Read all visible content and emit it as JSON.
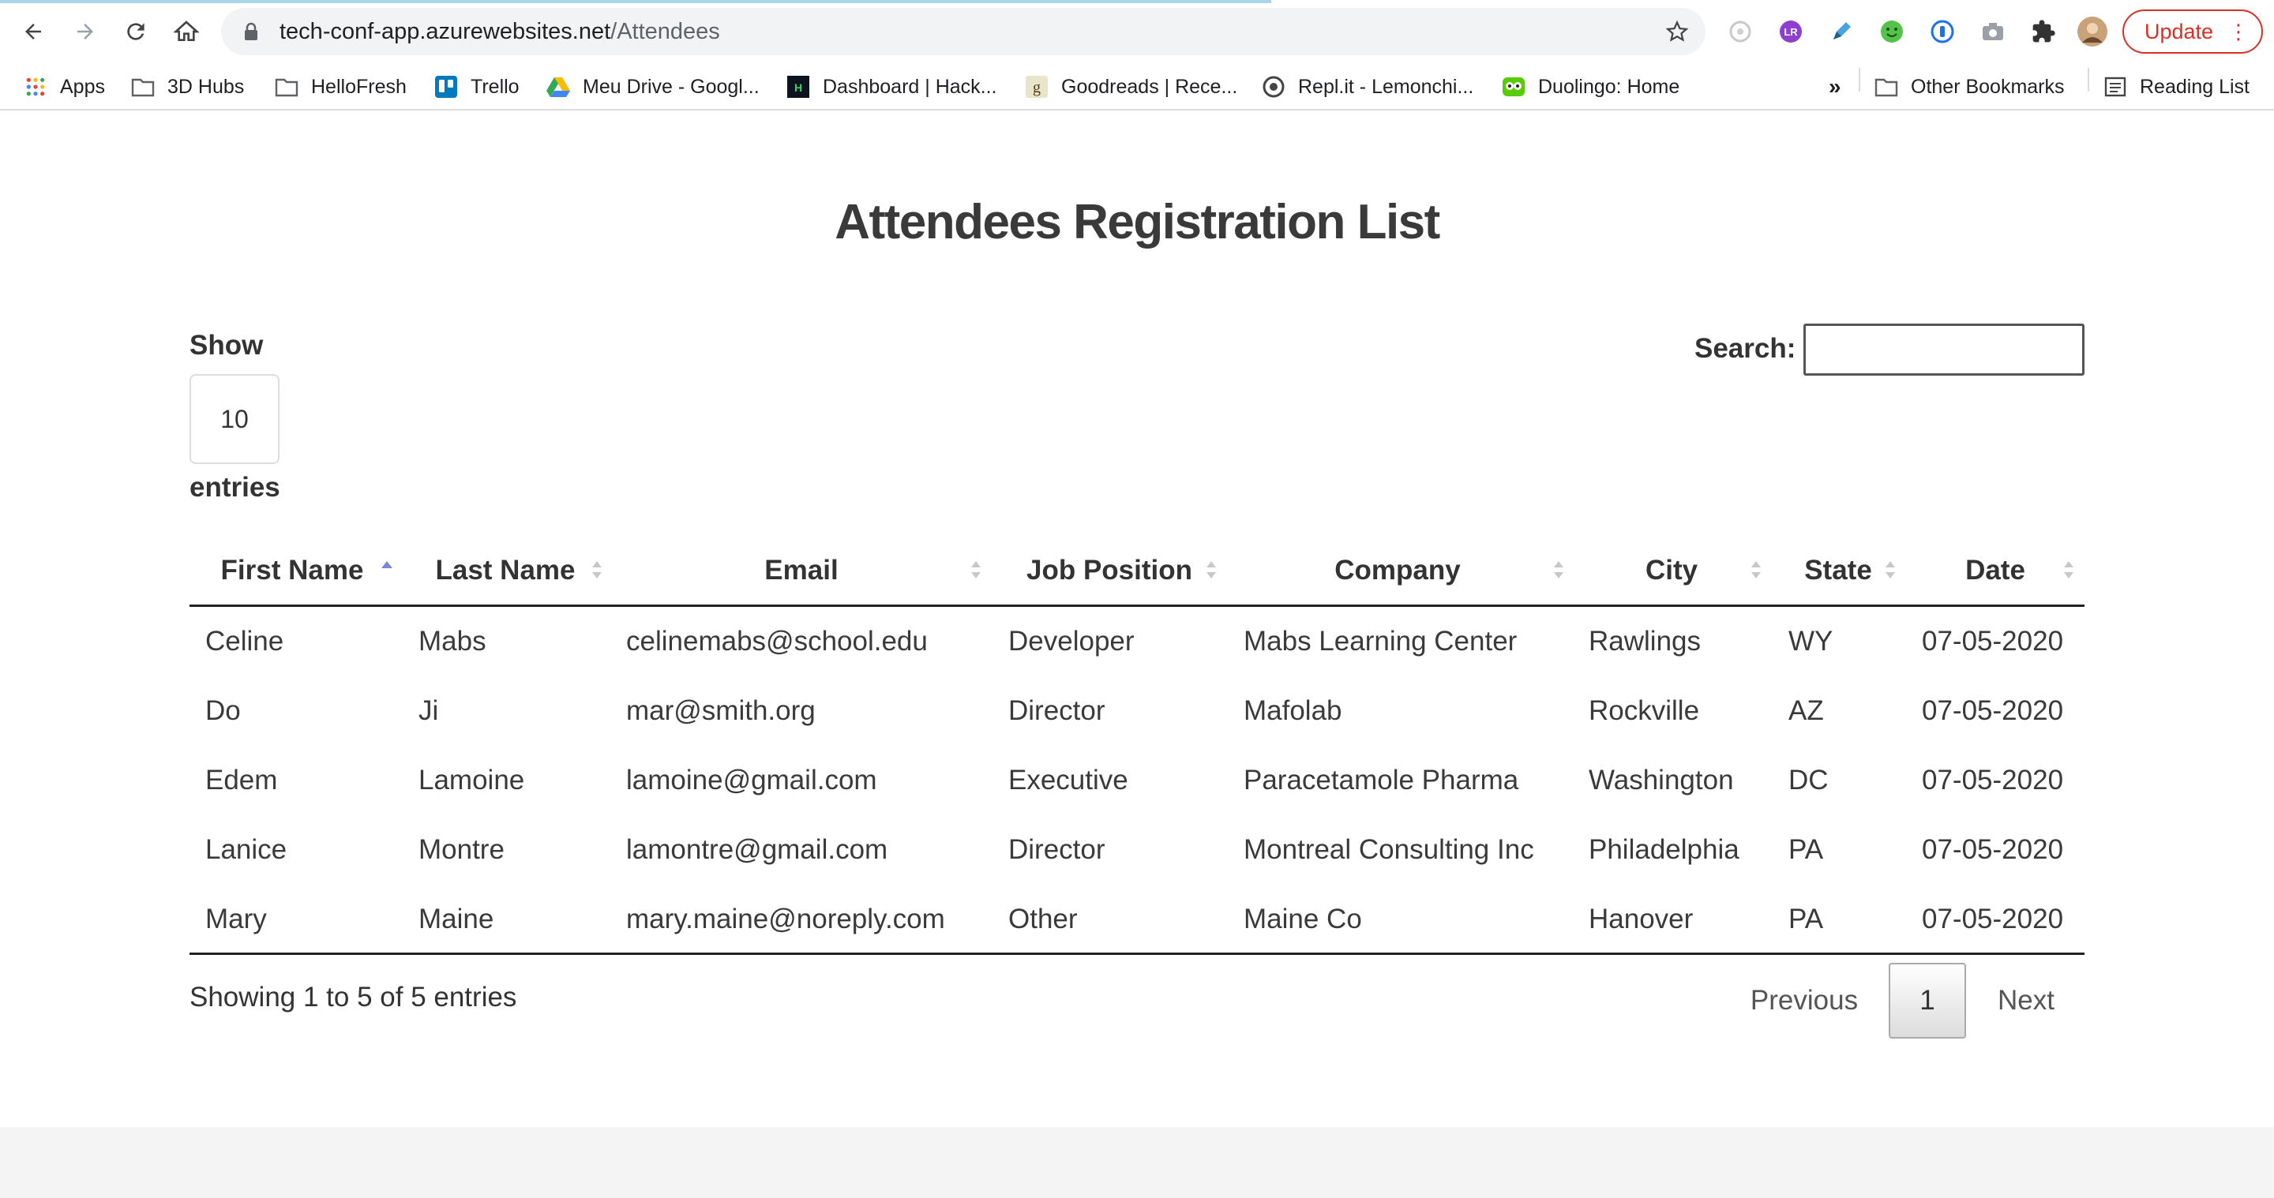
{
  "browser": {
    "url_host": "tech-conf-app.azurewebsites.net",
    "url_path": "/Attendees",
    "update_label": "Update",
    "bookmarks": [
      {
        "label": "Apps",
        "icon": "apps-grid-icon"
      },
      {
        "label": "3D Hubs",
        "icon": "folder-icon"
      },
      {
        "label": "HelloFresh",
        "icon": "folder-icon"
      },
      {
        "label": "Trello",
        "icon": "trello-icon"
      },
      {
        "label": "Meu Drive - Googl...",
        "icon": "google-drive-icon"
      },
      {
        "label": "Dashboard | Hack...",
        "icon": "hackerrank-icon"
      },
      {
        "label": "Goodreads | Rece...",
        "icon": "goodreads-icon"
      },
      {
        "label": "Repl.it - Lemonchi...",
        "icon": "replit-icon"
      },
      {
        "label": "Duolingo: Home",
        "icon": "duolingo-icon"
      }
    ],
    "overflow_label": "»",
    "other_bookmarks": "Other Bookmarks",
    "reading_list": "Reading List"
  },
  "page": {
    "title": "Attendees Registration List",
    "show_label": "Show",
    "page_length": "10",
    "entries_label": "entries",
    "search_label": "Search:",
    "search_value": ""
  },
  "table": {
    "columns": [
      "First Name",
      "Last Name",
      "Email",
      "Job Position",
      "Company",
      "City",
      "State",
      "Date"
    ],
    "sorted_column": "First Name",
    "sort_direction": "ascending",
    "rows": [
      [
        "Celine",
        "Mabs",
        "celinemabs@school.edu",
        "Developer",
        "Mabs Learning Center",
        "Rawlings",
        "WY",
        "07-05-2020"
      ],
      [
        "Do",
        "Ji",
        "mar@smith.org",
        "Director",
        "Mafolab",
        "Rockville",
        "AZ",
        "07-05-2020"
      ],
      [
        "Edem",
        "Lamoine",
        "lamoine@gmail.com",
        "Executive",
        "Paracetamole Pharma",
        "Washington",
        "DC",
        "07-05-2020"
      ],
      [
        "Lanice",
        "Montre",
        "lamontre@gmail.com",
        "Director",
        "Montreal Consulting Inc",
        "Philadelphia",
        "PA",
        "07-05-2020"
      ],
      [
        "Mary",
        "Maine",
        "mary.maine@noreply.com",
        "Other",
        "Maine Co",
        "Hanover",
        "PA",
        "07-05-2020"
      ]
    ]
  },
  "pagination": {
    "info": "Showing 1 to 5 of 5 entries",
    "previous": "Previous",
    "current_page": "1",
    "next": "Next"
  },
  "colors": {
    "sort_active": "#7a86d6",
    "sort_inactive": "#c8c8c8",
    "update_red": "#d93025"
  }
}
